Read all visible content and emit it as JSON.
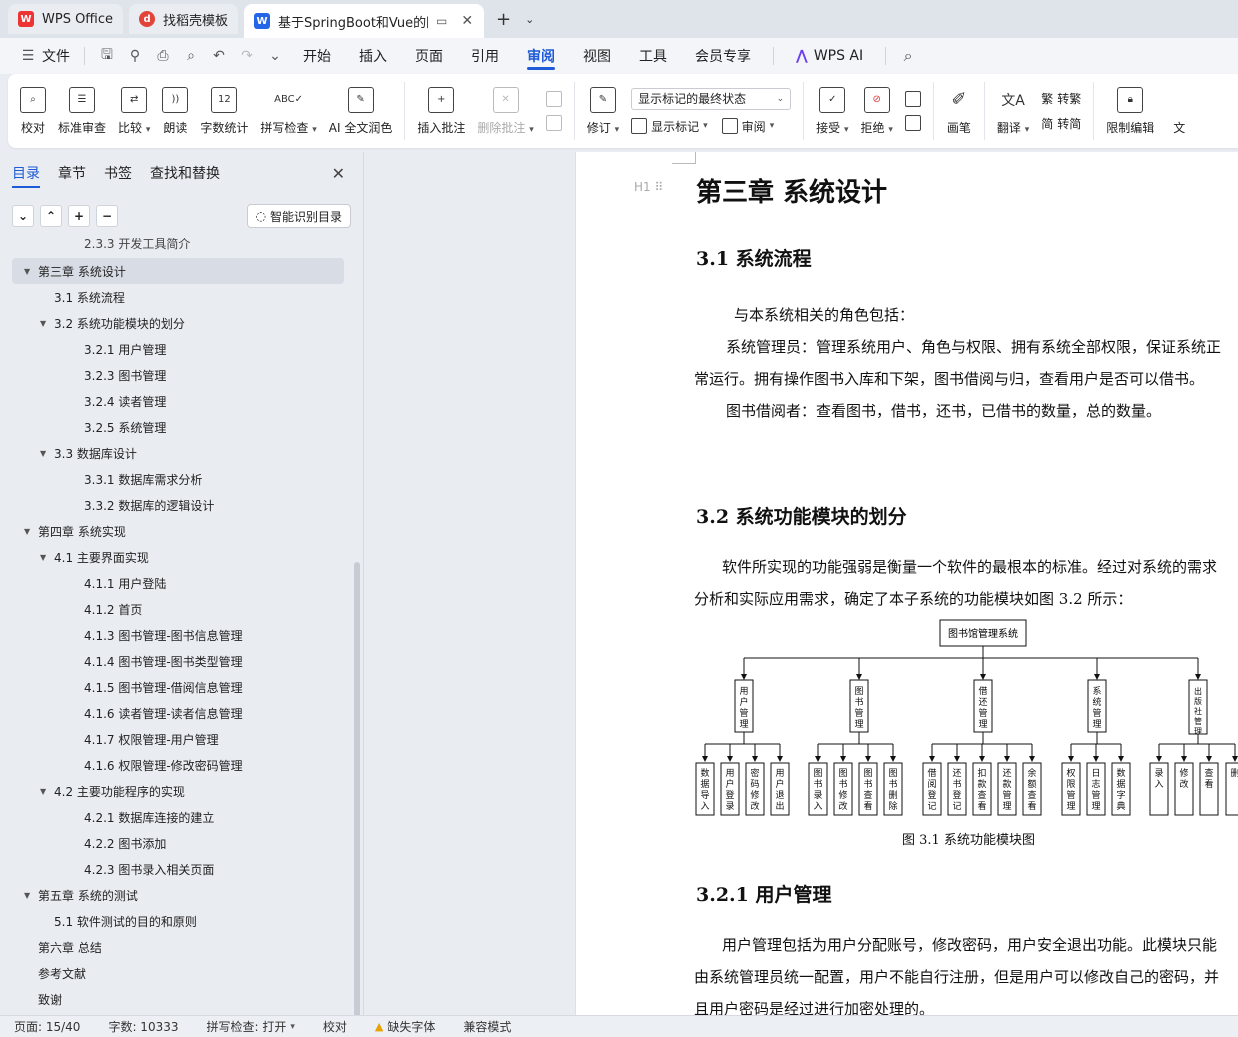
{
  "titlebar": {
    "tabs": [
      {
        "label": "WPS Office",
        "active": false
      },
      {
        "label": "找稻壳模板",
        "active": false
      },
      {
        "label": "基于SpringBoot和Vue的图书",
        "active": true
      }
    ]
  },
  "menubar": {
    "file_label": "文件",
    "items": [
      "开始",
      "插入",
      "页面",
      "引用",
      "审阅",
      "视图",
      "工具",
      "会员专享"
    ],
    "active": "审阅",
    "ai_label": "WPS AI"
  },
  "ribbon": {
    "proofread": "校对",
    "standard_review": "标准审查",
    "compare": "比较",
    "read_aloud": "朗读",
    "word_count": "字数统计",
    "spell_check": "拼写检查",
    "ai_proofread": "AI 全文润色",
    "insert_comment": "插入批注",
    "delete_comment": "删除批注",
    "revise": "修订",
    "display_select": "显示标记的最终状态",
    "show_marks": "显示标记",
    "review_pane": "审阅",
    "accept": "接受",
    "reject": "拒绝",
    "pen": "画笔",
    "translate": "翻译",
    "to_traditional": "转繁",
    "to_simplified": "转简",
    "restrict_edit": "限制编辑",
    "doc_truncated": "文"
  },
  "sidebar": {
    "tabs": [
      "目录",
      "章节",
      "书签",
      "查找和替换"
    ],
    "smart_toc": "智能识别目录",
    "toc": [
      {
        "text": "2.3.3 开发工具简介",
        "level": 3,
        "partial": true
      },
      {
        "text": "第三章  系统设计",
        "level": 1,
        "expanded": true,
        "selected": true
      },
      {
        "text": "3.1 系统流程",
        "level": 2
      },
      {
        "text": "3.2  系统功能模块的划分",
        "level": 2,
        "expanded": true
      },
      {
        "text": "3.2.1 用户管理",
        "level": 3
      },
      {
        "text": "3.2.3  图书管理",
        "level": 3
      },
      {
        "text": "3.2.4 读者管理",
        "level": 3
      },
      {
        "text": "3.2.5  系统管理",
        "level": 3
      },
      {
        "text": "3.3 数据库设计",
        "level": 2,
        "expanded": true
      },
      {
        "text": "3.3.1 数据库需求分析",
        "level": 3
      },
      {
        "text": "3.3.2 数据库的逻辑设计",
        "level": 3
      },
      {
        "text": "第四章  系统实现",
        "level": 1,
        "expanded": true
      },
      {
        "text": "4.1 主要界面实现",
        "level": 2,
        "expanded": true
      },
      {
        "text": "4.1.1 用户登陆",
        "level": 3
      },
      {
        "text": "4.1.2  首页",
        "level": 3
      },
      {
        "text": "4.1.3  图书管理-图书信息管理",
        "level": 3
      },
      {
        "text": "4.1.4 图书管理-图书类型管理",
        "level": 3
      },
      {
        "text": "4.1.5 图书管理-借阅信息管理",
        "level": 3
      },
      {
        "text": "4.1.6 读者管理-读者信息管理",
        "level": 3
      },
      {
        "text": "4.1.7 权限管理-用户管理",
        "level": 3
      },
      {
        "text": "4.1.6 权限管理-修改密码管理",
        "level": 3
      },
      {
        "text": "4.2 主要功能程序的实现",
        "level": 2,
        "expanded": true
      },
      {
        "text": "4.2.1  数据库连接的建立",
        "level": 3
      },
      {
        "text": "4.2.2 图书添加",
        "level": 3
      },
      {
        "text": "4.2.3 图书录入相关页面",
        "level": 3
      },
      {
        "text": "第五章  系统的测试",
        "level": 1,
        "expanded": true
      },
      {
        "text": "5.1    软件测试的目的和原则",
        "level": 2
      },
      {
        "text": "第六章    总结",
        "level": 1
      },
      {
        "text": "参考文献",
        "level": 1
      },
      {
        "text": "致谢",
        "level": 1
      }
    ]
  },
  "document": {
    "chapter_title": "第三章  系统设计",
    "heading_mark": "H1",
    "s31_title": "3.1 系统流程",
    "s31_p1": "与本系统相关的角色包括：",
    "s31_p2a": "系统管理员：管理系统用户、角色与权限、拥有系统全部权限，保证系统正",
    "s31_p2b": "常运行。拥有操作图书入库和下架，图书借阅与归，查看用户是否可以借书。",
    "s31_p3": "图书借阅者：查看图书，借书，还书，已借书的数量，总的数量。",
    "s32_title": "3.2  系统功能模块的划分",
    "s32_p1a": "软件所实现的功能强弱是衡量一个软件的最根本的标准。经过对系统的需求",
    "s32_p1b": "分析和实际应用需求，确定了本子系统的功能模块如图 3.2 所示：",
    "figure_caption": "图 3.1  系统功能模块图",
    "s321_title": "3.2.1 用户管理",
    "s321_p1a": "用户管理包括为用户分配账号，修改密码，用户安全退出功能。此模块只能",
    "s321_p1b": "由系统管理员统一配置，用户不能自行注册，但是用户可以修改自己的密码，并",
    "s321_p1c": "且用户密码是经过进行加密处理的。"
  },
  "diagram": {
    "root": "图书馆管理系统",
    "modules": [
      {
        "name": "用户管理",
        "children": [
          "数据导入",
          "用户登录",
          "密码修改",
          "用户退出"
        ]
      },
      {
        "name": "图书管理",
        "children": [
          "图书录入",
          "图书修改",
          "图书查看",
          "图书删除"
        ]
      },
      {
        "name": "借还管理",
        "children": [
          "借阅登记",
          "还书登记",
          "扣款查看",
          "还款管理",
          "余额查看"
        ]
      },
      {
        "name": "系统管理",
        "children": [
          "权限管理",
          "日志管理",
          "数据字典"
        ]
      },
      {
        "name": "出版社管理",
        "children": [
          "录入",
          "修改",
          "查看",
          "删"
        ]
      }
    ]
  },
  "statusbar": {
    "page": "页面: 15/40",
    "words": "字数: 10333",
    "spell": "拼写检查: 打开",
    "proof": "校对",
    "missing_font": "缺失字体",
    "compat": "兼容模式"
  }
}
